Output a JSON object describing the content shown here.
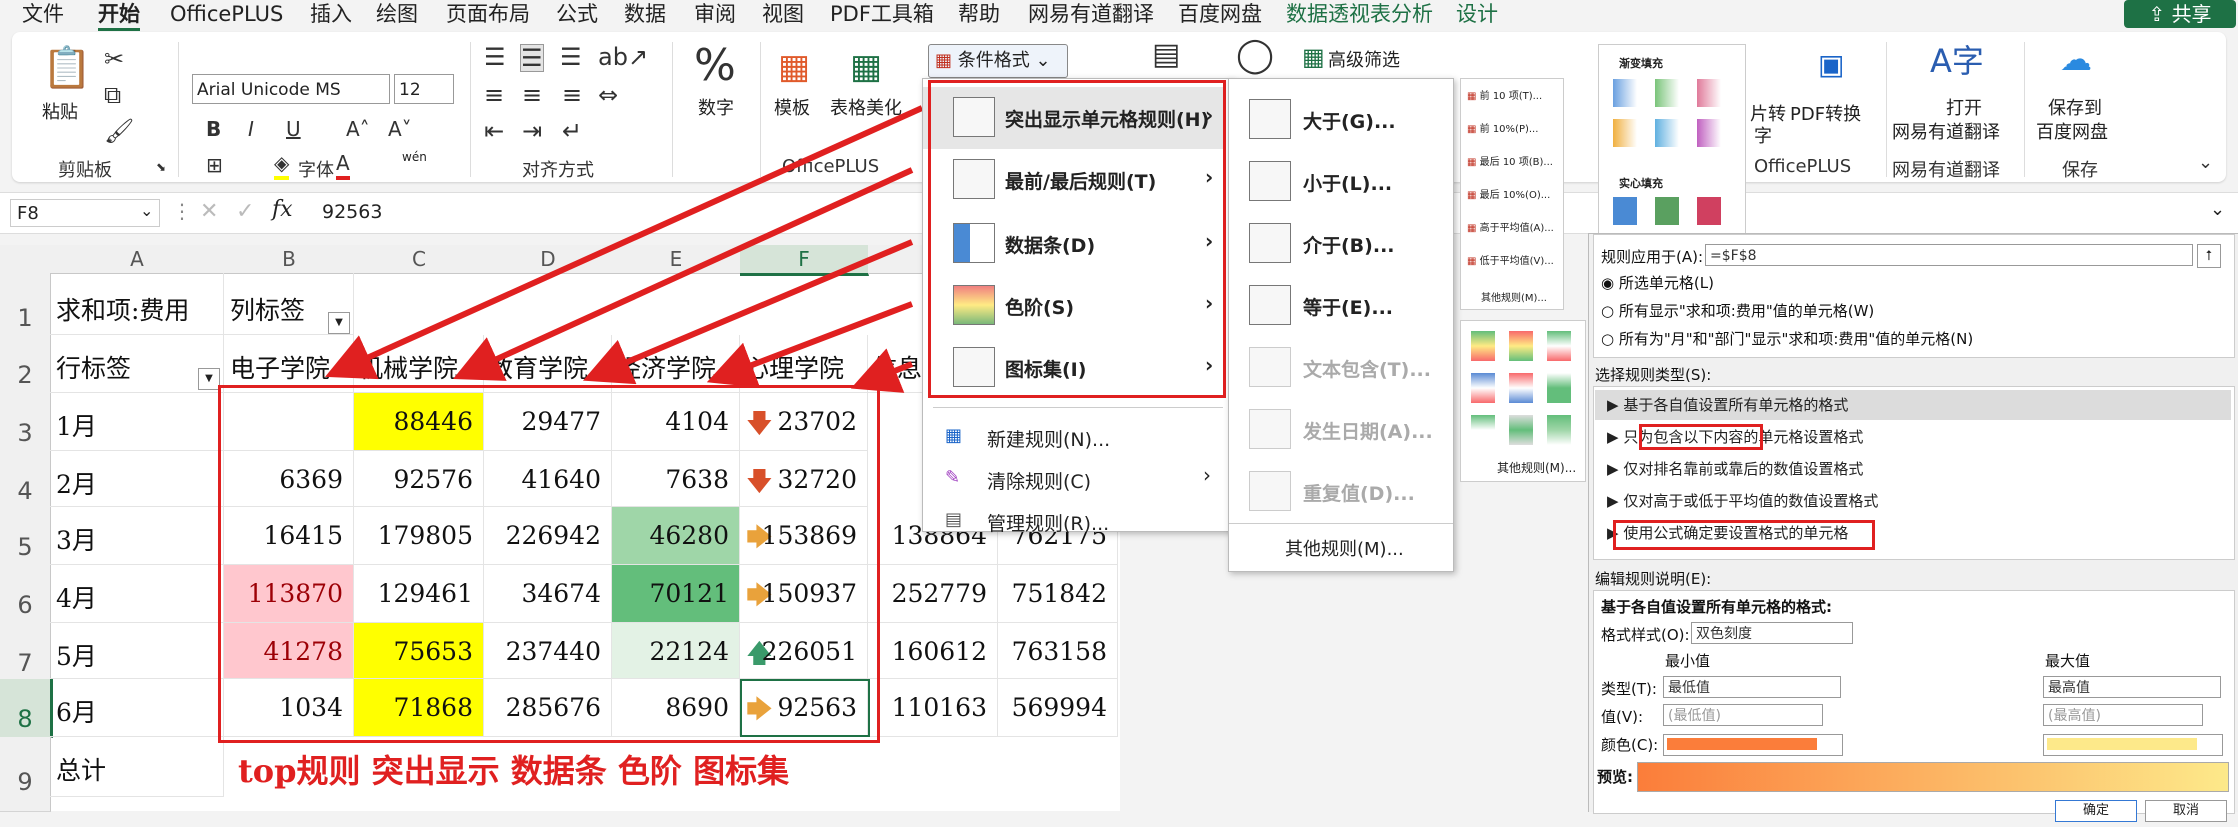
{
  "menubar": {
    "tabs": [
      "文件",
      "开始",
      "OfficePLUS",
      "插入",
      "绘图",
      "页面布局",
      "公式",
      "数据",
      "审阅",
      "视图",
      "PDF工具箱",
      "帮助",
      "网易有道翻译",
      "百度网盘",
      "数据透视表分析",
      "设计"
    ],
    "share": "共享"
  },
  "ribbon": {
    "paste": "粘贴",
    "clipboard": "剪贴板",
    "font_name": "Arial Unicode MS",
    "font_size": "12",
    "font_group": "字体",
    "align_group": "对齐方式",
    "number": "数字",
    "template": "模板",
    "table_beautify": "表格美化",
    "officeplus": "OfficePLUS",
    "cond_format": "条件格式",
    "advanced_filter": "高级筛选",
    "pdf_convert": "PDF转换",
    "img_convert": "片转",
    "img_convert2": "字",
    "officeplus2": "OfficePLUS",
    "open_youdao": "打开",
    "youdao": "网易有道翻译",
    "youdao_group": "网易有道翻译",
    "save_to": "保存到",
    "baidu": "百度网盘",
    "save_group": "保存",
    "wen": "wén",
    "gradient_fill": "渐变填充",
    "solid_fill": "实心填充",
    "other_rules_small": "其他规则(M)...",
    "top_items": [
      "前 10 项(T)...",
      "前 10%(P)...",
      "最后 10 项(B)...",
      "最后 10%(O)...",
      "高于平均值(A)...",
      "低于平均值(V)..."
    ],
    "other_rules_small2": "其他规则(M)..."
  },
  "formula": {
    "name_box": "F8",
    "fx": "fx",
    "value": "92563"
  },
  "sheet": {
    "col_headers": [
      "A",
      "B",
      "C",
      "D",
      "E",
      "F"
    ],
    "row_headers": [
      "1",
      "2",
      "3",
      "4",
      "5",
      "6",
      "7",
      "8",
      "9"
    ],
    "a1": "求和项:费用",
    "b1": "列标签",
    "a2": "行标签",
    "headers": [
      "电子学院",
      "机械学院",
      "教育学院",
      "经济学院",
      "心理学院",
      "信息"
    ],
    "rows": [
      {
        "label": "1月",
        "b": "",
        "c": "88446",
        "d": "29477",
        "e": "4104",
        "f": "23702",
        "g": "",
        "h": ""
      },
      {
        "label": "2月",
        "b": "6369",
        "c": "92576",
        "d": "41640",
        "e": "7638",
        "f": "32720",
        "g": "",
        "h": ""
      },
      {
        "label": "3月",
        "b": "16415",
        "c": "179805",
        "d": "226942",
        "e": "46280",
        "f": "153869",
        "g": "138864",
        "h": "762175"
      },
      {
        "label": "4月",
        "b": "113870",
        "c": "129461",
        "d": "34674",
        "e": "70121",
        "f": "150937",
        "g": "252779",
        "h": "751842"
      },
      {
        "label": "5月",
        "b": "41278",
        "c": "75653",
        "d": "237440",
        "e": "22124",
        "f": "226051",
        "g": "160612",
        "h": "763158"
      },
      {
        "label": "6月",
        "b": "1034",
        "c": "71868",
        "d": "285676",
        "e": "8690",
        "f": "92563",
        "g": "110163",
        "h": "569994"
      }
    ],
    "total": "总计",
    "footnote": "top规则 突出显示  数据条  色阶  图标集"
  },
  "cf_menu": {
    "items": [
      "突出显示单元格规则(H)",
      "最前/最后规则(T)",
      "数据条(D)",
      "色阶(S)",
      "图标集(I)"
    ],
    "subitems": [
      "新建规则(N)...",
      "清除规则(C)",
      "管理规则(R)..."
    ]
  },
  "highlight_submenu": {
    "items": [
      "大于(G)...",
      "小于(L)...",
      "介于(B)...",
      "等于(E)...",
      "文本包含(T)...",
      "发生日期(A)...",
      "重复值(D)..."
    ],
    "other": "其他规则(M)..."
  },
  "dialog": {
    "apply_label": "规则应用于(A):",
    "apply_value": "=$F$8",
    "radio1": "所选单元格(L)",
    "radio2": "所有显示\"求和项:费用\"值的单元格(W)",
    "radio3": "所有为\"月\"和\"部门\"显示\"求和项:费用\"值的单元格(N)",
    "select_type": "选择规则类型(S):",
    "rule_types": [
      "基于各自值设置所有单元格的格式",
      "只为包含以下内容的单元格设置格式",
      "仅对排名靠前或靠后的数值设置格式",
      "仅对高于或低于平均值的数值设置格式",
      "使用公式确定要设置格式的单元格"
    ],
    "edit_desc": "编辑规则说明(E):",
    "desc_title": "基于各自值设置所有单元格的格式:",
    "format_style_label": "格式样式(O):",
    "format_style": "双色刻度",
    "min_label": "最小值",
    "max_label": "最大值",
    "type_label": "类型(T):",
    "min_type": "最低值",
    "max_type": "最高值",
    "value_label": "值(V):",
    "min_value": "(最低值)",
    "max_value": "(最高值)",
    "color_label": "颜色(C):",
    "preview_label": "预览:",
    "ok": "确定",
    "cancel": "取消"
  },
  "colors": {
    "excel_green": "#1e7145",
    "highlight_red": "#e02020",
    "yellow": "#ffff00",
    "databar_orange": "#f4a93a",
    "scale_green_dark": "#63be7b",
    "scale_green_mid": "#9fd6a8",
    "pink": "#ffc7ce",
    "min_color": "#fb7d3a",
    "max_color": "#fde98a"
  }
}
